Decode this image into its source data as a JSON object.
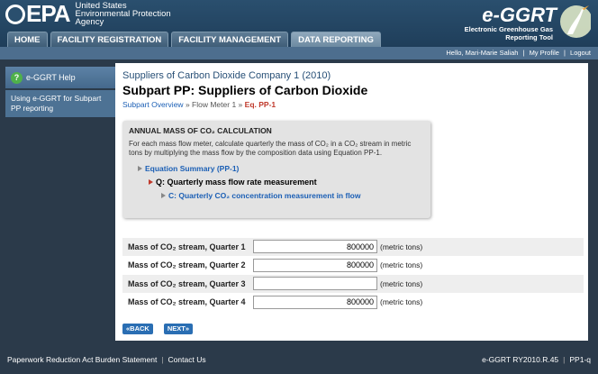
{
  "header": {
    "logo_text": "EPA",
    "agency_lines": [
      "United States",
      "Environmental Protection",
      "Agency"
    ],
    "brand_title": "e-GGRT",
    "brand_sub_lines": [
      "Electronic Greenhouse Gas",
      "Reporting Tool"
    ],
    "nav": [
      "HOME",
      "FACILITY REGISTRATION",
      "FACILITY MANAGEMENT",
      "DATA REPORTING"
    ],
    "active_tab": "DATA REPORTING"
  },
  "util_bar": {
    "greeting": "Hello, Mari-Marie Saliah",
    "my_profile": "My Profile",
    "logout": "Logout"
  },
  "sidebar": {
    "help_label": "e-GGRT Help",
    "link_label": "Using e-GGRT for Subpart PP reporting"
  },
  "main": {
    "company": "Suppliers of Carbon Dioxide Company 1 (2010)",
    "title": "Subpart PP: Suppliers of Carbon Dioxide",
    "breadcrumb": {
      "overview": "Subpart Overview",
      "sep1": "»",
      "meter": "Flow Meter 1",
      "sep2": "»",
      "current": "Eq. PP-1"
    },
    "info": {
      "title": "ANNUAL MASS OF CO₂ CALCULATION",
      "description": "For each mass flow meter, calculate quarterly the mass of CO₂ in a CO₂ stream in metric tons by multiplying the mass flow by the composition data using Equation PP-1.",
      "eq_summary": "Equation Summary (PP-1)",
      "eq_q": "Q: Quarterly mass flow rate measurement",
      "eq_c": "C: Quarterly CO₂ concentration measurement in flow"
    },
    "rows": [
      {
        "label": "Mass of CO₂ stream, Quarter 1",
        "value": "800000",
        "unit": "(metric tons)"
      },
      {
        "label": "Mass of CO₂ stream, Quarter 2",
        "value": "800000",
        "unit": "(metric tons)"
      },
      {
        "label": "Mass of CO₂ stream, Quarter 3",
        "value": "",
        "unit": "(metric tons)"
      },
      {
        "label": "Mass of CO₂ stream, Quarter 4",
        "value": "800000",
        "unit": "(metric tons)"
      }
    ],
    "back_label": "«BACK",
    "next_label": "NEXT»"
  },
  "footer": {
    "prs": "Paperwork Reduction Act Burden Statement",
    "contact": "Contact Us",
    "version": "e-GGRT RY2010.R.45",
    "page_id": "PP1-q"
  }
}
